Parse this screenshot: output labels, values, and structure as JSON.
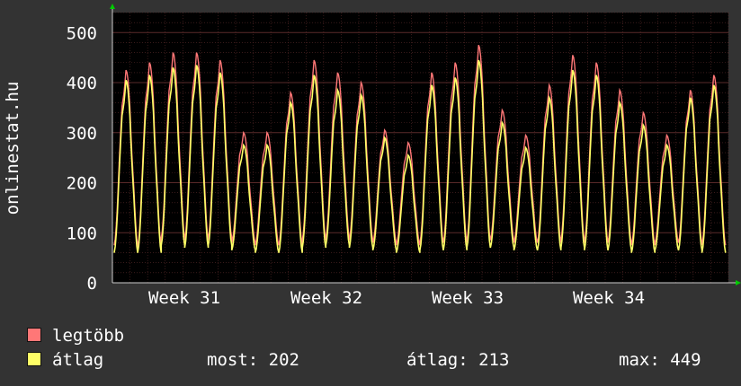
{
  "colors": {
    "background": "#333333",
    "plot_background": "#000000",
    "grid": "#5a2a2a",
    "text": "#ffffff",
    "max_series": "#ff7777",
    "avg_series": "#ffff66",
    "axis_arrow": "#00cc00"
  },
  "chart_data": {
    "type": "line",
    "ylabel": "onlinestat.hu",
    "ylim": [
      0,
      540
    ],
    "yticks": [
      0,
      100,
      200,
      300,
      400,
      500
    ],
    "xticks": [
      "Week 31",
      "Week 32",
      "Week 33",
      "Week 34"
    ],
    "grid": true,
    "days": 35,
    "series": [
      {
        "name": "legtöbb",
        "daily_peaks": [
          425,
          440,
          460,
          460,
          445,
          300,
          300,
          380,
          445,
          420,
          400,
          305,
          280,
          420,
          440,
          475,
          345,
          295,
          395,
          455,
          440,
          385,
          340,
          295,
          385,
          415
        ],
        "daily_lows": [
          75,
          70,
          90,
          85,
          90,
          80,
          75,
          75,
          85,
          90,
          85,
          80,
          75,
          80,
          80,
          85,
          85,
          80,
          80,
          85,
          80,
          80,
          75,
          80,
          80,
          75
        ]
      },
      {
        "name": "átlag",
        "daily_peaks": [
          405,
          415,
          430,
          435,
          420,
          275,
          275,
          360,
          415,
          385,
          375,
          290,
          255,
          395,
          410,
          445,
          320,
          270,
          370,
          425,
          415,
          360,
          315,
          275,
          370,
          395
        ],
        "daily_lows": [
          60,
          60,
          75,
          70,
          75,
          65,
          60,
          60,
          70,
          75,
          70,
          65,
          60,
          65,
          65,
          70,
          70,
          65,
          65,
          70,
          65,
          65,
          60,
          65,
          65,
          60
        ]
      }
    ]
  },
  "legend": {
    "max_label": "legtöbb",
    "avg_label": "átlag"
  },
  "stats": {
    "current": "most: 202",
    "average": "átlag: 213",
    "maximum": "max: 449"
  }
}
